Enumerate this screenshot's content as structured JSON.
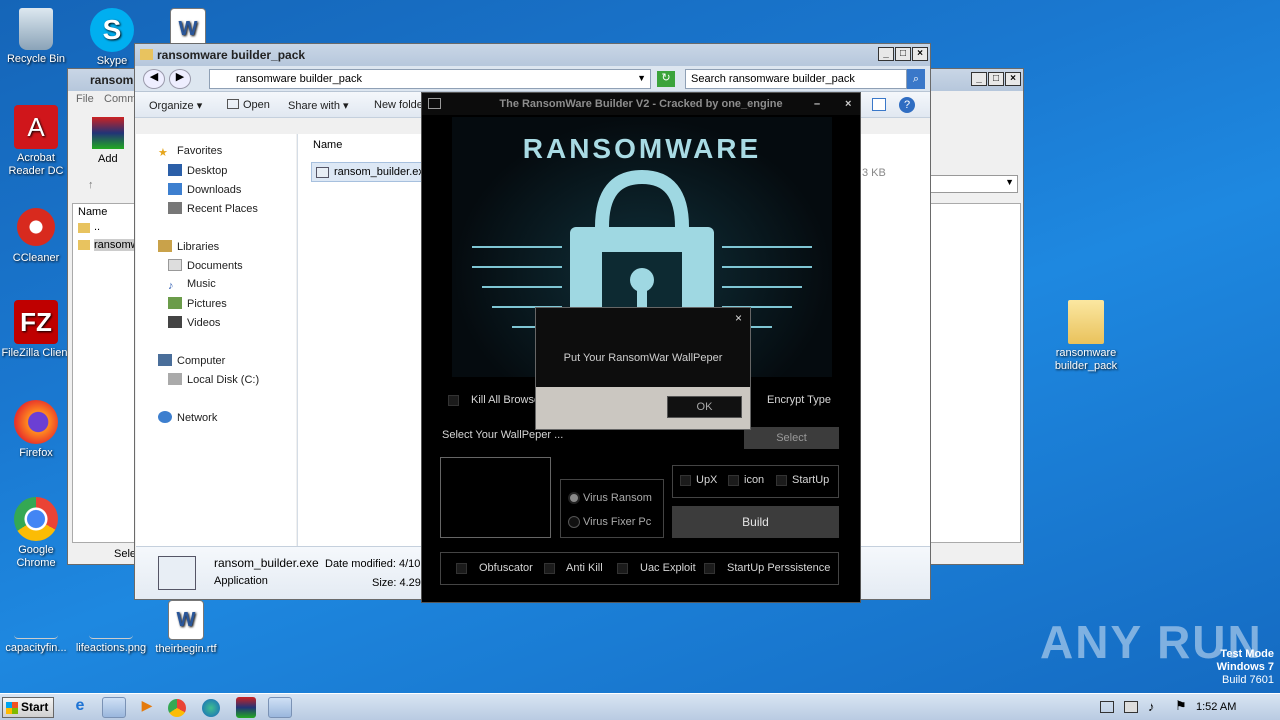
{
  "desktop_icons": [
    {
      "label": "Recycle Bin",
      "icon": "recycle-bin-icon"
    },
    {
      "label": "Skype",
      "icon": "skype-icon"
    },
    {
      "label": "Acrobat Reader DC",
      "icon": "acrobat-icon"
    },
    {
      "label": "CCleaner",
      "icon": "ccleaner-icon"
    },
    {
      "label": "FileZilla Client",
      "icon": "filezilla-icon"
    },
    {
      "label": "Firefox",
      "icon": "firefox-icon"
    },
    {
      "label": "Google Chrome",
      "icon": "chrome-icon"
    },
    {
      "label": "capacityfin...",
      "icon": "file-icon"
    },
    {
      "label": "lifeactions.png",
      "icon": "image-file-icon"
    },
    {
      "label": "theirbegin.rtf",
      "icon": "word-doc-icon"
    },
    {
      "label": "ransomware builder_pack",
      "icon": "folder-icon"
    }
  ],
  "winrar": {
    "title": "ransom",
    "menu": [
      "File",
      "Comm"
    ],
    "add_label": "Add",
    "col_name": "Name",
    "rows": [
      "..",
      "ransomw"
    ],
    "status": "Sele"
  },
  "explorer": {
    "title": "ransomware builder_pack",
    "address": "ransomware builder_pack",
    "search_placeholder": "Search ransomware builder_pack",
    "commands": [
      "Organize",
      "Open",
      "Share with",
      "New folde"
    ],
    "nav": {
      "favorites": "Favorites",
      "favorites_items": [
        "Desktop",
        "Downloads",
        "Recent Places"
      ],
      "libraries": "Libraries",
      "libraries_items": [
        "Documents",
        "Music",
        "Pictures",
        "Videos"
      ],
      "computer": "Computer",
      "computer_items": [
        "Local Disk (C:)"
      ],
      "network": "Network"
    },
    "col_name": "Name",
    "file": "ransom_builder.exe",
    "size_fragment": "3 KB",
    "details": {
      "name": "ransom_builder.exe",
      "date_label": "Date modified: 4/10",
      "type": "Application",
      "size_label": "Size: 4.29"
    }
  },
  "ransomware_app": {
    "title": "The RansomWare Builder V2 - Cracked by one_engine",
    "banner": "RANSOMWARE",
    "kill_browsers": "Kill All Browse",
    "encrypt_type": "Encrypt Type",
    "select_wallpaper": "Select Your WallPeper ...",
    "select_button": "Select",
    "radio": [
      "Virus Ransom",
      "Virus Fixer Pc"
    ],
    "options": [
      "UpX",
      "icon",
      "StartUp"
    ],
    "build_button": "Build",
    "bottom_options": [
      "Obfuscator",
      "Anti Kill",
      "Uac Exploit",
      "StartUp Perssistence"
    ]
  },
  "dialog": {
    "message": "Put Your RansomWar WallPeper",
    "ok": "OK"
  },
  "watermark": "ANY RUN",
  "testmode": [
    "Test Mode",
    "Windows 7",
    "Build 7601"
  ],
  "taskbar": {
    "start": "Start",
    "clock": "1:52 AM"
  }
}
